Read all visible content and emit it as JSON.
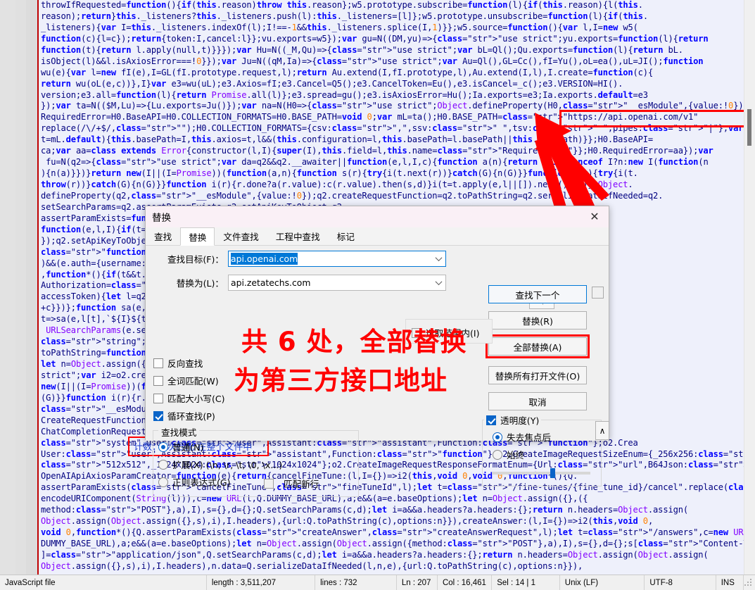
{
  "editor": {
    "language_icon": "javascript-file",
    "url_highlight": "https://api.openai.com/v1",
    "count_annotation": "计数：6次匹配 在整个文件中",
    "lines": [
      "throwIfRequested=function(){if(this.reason)throw this.reason};w5.prototype.subscribe=function(l){if(this.reason){l(this.",
      "reason);return}this._listeners?this._listeners.push(l):this._listeners=[l]};w5.prototype.unsubscribe=function(l){if(this.",
      "_listeners){var I=this._listeners.indexOf(l);I!==-1&&this._listeners.splice(I,1)}};w5.source=function(){var l,I=new w5(",
      "function(c){l=c});return{token:I,cancel:l}};vu.exports=w5});var gu=N((DM,yu)=>{\"use strict\";yu.exports=function(l){return",
      "function(t){return l.apply(null,t)}}});var Hu=N((_M,Qu)=>{\"use strict\";var bL=Ql();Qu.exports=function(l){return bL.",
      "isObject(l)&&l.isAxiosError===!0}});var Ju=N((qM,Ia)=>{\"use strict\";var Au=Ql(),GL=Cc(),fI=Yu(),oL=ea(),uL=JI();function",
      "wu(e){var l=new fI(e),I=GL(fI.prototype.request,l);return Au.extend(I,fI.prototype,l),Au.extend(I,l),I.create=function(c){",
      "return wu(oL(e,c))},I}var e3=wu(uL);e3.Axios=fI;e3.Cancel=Q5();e3.CancelToken=Eu(),e3.isCancel=_c();e3.VERSION=HI().",
      "version;e3.all=function(l){return Promise.all(l)};e3.spread=gu();e3.isAxiosError=Hu();Ia.exports=e3;Ia.exports.default=e3",
      "});var ta=N(($M,Lu)=>{Lu.exports=Ju()});var na=N(H0=>{\"use strict\";Object.defineProperty(H0,\"__esModule\",{value:!0});H0.",
      "RequiredError=H0.BaseAPI=H0.COLLECTION_FORMATS=H0.BASE_PATH=void 0;var mL=ta();H0.BASE_PATH=\"https://api.openai.com/v1\"",
      "replace(/\\/+$/,\"\");H0.COLLECTION_FORMATS={csv:\",\",ssv:\" \",tsv:\"\t\",pipes:\"|\"};var ca=class{constructor(l,I=H0.BASE_PATH,",
      "t=mL.default){this.basePath=I,this.axios=t,l&&(this.configuration=l,this.basePath=l.basePath||this.basePath)}};H0.BaseAPI=",
      "ca;var aa=class extends Error{constructor(l,I){super(I),this.field=l,this.name=\"RequiredError\"}};H0.RequiredError=aa});var",
      " fu=N(q2=>{\"use strict\";var da=q2&&q2.__awaiter||function(e,l,I,c){function a(n){return n instanceof I?n:new I(function(n",
      "){n(a)}})}return new(I||(I=Promise))(function(a,n){function s(r){try{i(t.next(r))}catch(G){n(G)}}function c(r){try{i(t.",
      "throw(r))}catch(G){n(G)}}function i(r){r.done?a(r.value):c(r.value).then(s,d)}i(t=t.apply(e,l||[]).next())}})};Object.",
      "defineProperty(q2,\"__esModule\",{value:!0});q2.createRequestFunction=q2.toPathString=q2.serializeDataIfNeeded=q2.",
      "setSearchParams=q2.assertParamExists=q2.setApiKeyToObject=q2.",
      "assertParamExists=function(e,l,I){if(t===void 0)throw new aa(l,`Required parameter ${e}.`",
      "function(e,l,I){if(t===void 0)throw new RequiredError=",
      "});q2.setApiKeyToObject=function(e,l,I){if(t===void 0) t=typeof I.apiKey==",
      "\"function\"?yield I.apiKey(l):yield I.apiKey)&&(e.auth={username||l.password",
      ")&&(e.auth={username:l.username,password:l.password})} da(this,void 0,void 0",
      ",function*(){if(t&&t.accessToken){let l=typeof t.accessToken;e.",
      "Authorization=\"Bearer \"+c}})};function*(){if(t&&t.",
      "accessToken){let l=q2.setSearchParams=Object.keys(l).forEach(",
      "+c}})};function sa(e,l,I){Object.keys(l).forEach(tion(e,...l){let I=new",
      "t=>sa(e,l[t],`${I}${t}`))}function URLSearchParams",
      " URLSearchParams(e.search),l=function(t) et t=typeof e!=",
      "\"string\";return(c=l,a=I)=>{d 0?e:{}):e||\"\"};q2.",
      "toPathString=function(e){return(c=l,a=I)=>{",
      "let n=Object.assign({},e);var xu=N(o2=>{\"use",
      "strict\";var i2=o2.createRequestFunction=ion(n){n(a)}}return",
      "new(I||(I=Promise))(function(a,n)t.throw(r))}catch(G){n",
      "(G)}}function i(r){r.done?efineProperty(o2,",
      "\"__esModule\",{value:!0});o2.or=o2.",
      "CreateRequestFunction=o2.CreateImageRequestSizeEnum=o2.",
      "ChatCompletionRequestMessageRoleEnum={System:\"system\",",
      "\"system\",User:\"user\",Assistant:\"assistant\",Function:\"function\"};o2.Crea",
      "User:\"user\",Assistant:\"assistant\",Function:\"function\"};o2.CreateImageRequestSizeEnum={_256x256:\"256x256\",_512x512:",
      "\"512x512\",_1024x1024:\"1024x1024\"};o2.CreateImageRequestResponseFormatEnum={Url:\"url\",B64Json:\"b64_json\"};o2.",
      "OpenAIApiAxiosParamCreator=function(e){return{cancelFineTune:(l,I={})=>i2(this,void 0,void 0,function*(){Q.",
      "assertParamExists(\"cancelFineTune\",\"fineTuneId\",l);let t=\"/fine-tunes/{fine_tune_id}/cancel\".replace(\"{fine_tune_id}\",",
      "encodeURIComponent(String(l))),c=new URL(t,Q.DUMMY_BASE_URL),a;e&&(a=e.baseOptions);let n=Object.assign({},({",
      "method:\"POST\"},a),I),s={},d={};Q.setSearchParams(c,d);let i=a&&a.headers?a.headers:{};return n.headers=Object.assign(",
      "Object.assign(Object.assign({},s),i),I.headers),{url:Q.toPathString(c),options:n}}),createAnswer:(l,I={})=>i2(this,void 0,",
      "void 0,function*(){Q.assertParamExists(\"createAnswer\",\"createAnswerRequest\",l);let t=\"/answers\",c=new URL(t,Q.",
      "DUMMY_BASE_URL),a;e&&(a=e.baseOptions);let n=Object.assign(Object.assign({method:\"POST\"},a),I),s={},d={};s[\"Content-Type\"",
      "]=\"application/json\",Q.setSearchParams(c,d);let i=a&&a.headers?a.headers:{};return n.headers=Object.assign(Object.assign(",
      "Object.assign({},s),i),I.headers),n.data=Q.serializeDataIfNeeded(l,n,e),{url:Q.toPathString(c),options:n}}),"
    ]
  },
  "dialog": {
    "title": "替换",
    "close_icon": "close-icon",
    "tabs": [
      {
        "label": "查找",
        "active": false
      },
      {
        "label": "替换",
        "active": true
      },
      {
        "label": "文件查找",
        "active": false
      },
      {
        "label": "工程中查找",
        "active": false
      },
      {
        "label": "标记",
        "active": false
      }
    ],
    "find_label": "查找目标(F)：",
    "find_value": "api.openai.com",
    "replace_label": "替换为(L)：",
    "replace_value": "api.zetatechs.com",
    "swap_icon": "swap-arrows-icon",
    "buttons": {
      "find_next": "查找下一个",
      "replace": "替换(R)",
      "replace_all": "全部替换(A)",
      "replace_all_opened": "替换所有打开文件(O)",
      "cancel": "取消"
    },
    "in_selection": {
      "label": "选取范围内(I)",
      "checked": false
    },
    "options": [
      {
        "label": "反向查找",
        "checked": false
      },
      {
        "label": "全词匹配(W)",
        "checked": false
      },
      {
        "label": "匹配大小写(C)",
        "checked": false
      },
      {
        "label": "循环查找(P)",
        "checked": true
      }
    ],
    "search_mode": {
      "title": "查找模式",
      "items": [
        {
          "label": "普通(N)",
          "selected": true
        },
        {
          "label": "扩展(X) (\\n, \\r, \\t, \\0, \\x...)",
          "selected": false
        },
        {
          "label": "正则表达式(G)",
          "selected": false
        }
      ],
      "match_newline": {
        "label": ". 匹配新行",
        "checked": false
      }
    },
    "transparency": {
      "title": "透明度(Y)",
      "checked": true,
      "items": [
        {
          "label": "失去焦点后",
          "selected": true
        },
        {
          "label": "始终",
          "selected": false
        }
      ],
      "slider_value": 60
    },
    "collapse_icon": "chevron-up-icon"
  },
  "annotation": {
    "line1": "共 6 处，全部替换",
    "line2": "为第三方接口地址",
    "color": "#ff0000",
    "arrow_icon": "red-arrow-icon"
  },
  "statusbar": {
    "file_type": "JavaScript file",
    "length": "length : 3,511,207",
    "lines": "lines : 732",
    "ln": "Ln : 207",
    "col": "Col : 16,461",
    "sel": "Sel : 14 | 1",
    "eol": "Unix (LF)",
    "encoding": "UTF-8",
    "insert_mode": "INS",
    "grip_icon": "resize-grip-icon"
  }
}
